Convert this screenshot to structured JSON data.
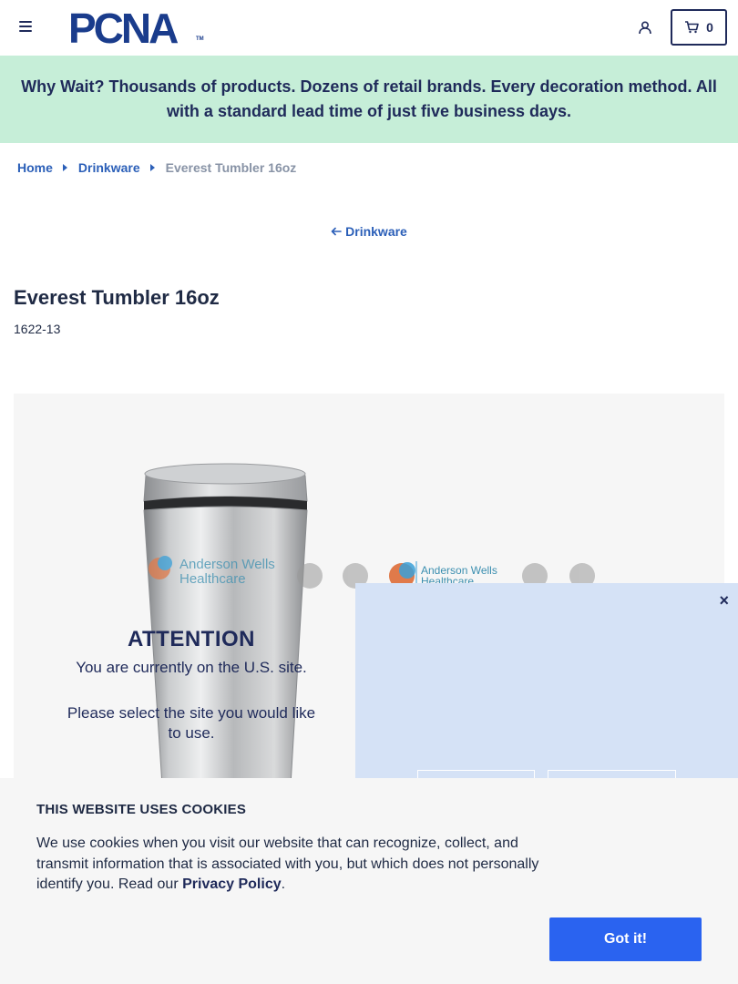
{
  "header": {
    "logo_text": "PCNA",
    "logo_tm": "TM",
    "cart_count": "0"
  },
  "banner": {
    "text": "Why Wait? Thousands of products. Dozens of retail brands. Every decoration method. All with a standard lead time of just five business days."
  },
  "breadcrumb": {
    "items": [
      "Home",
      "Drinkware"
    ],
    "current": "Everest Tumbler 16oz"
  },
  "back_link": {
    "label": "Drinkware"
  },
  "product": {
    "title": "Everest Tumbler 16oz",
    "sku": "1622-13",
    "imprint_text_line1": "Anderson Wells",
    "imprint_text_line2": "Healthcare"
  },
  "modal": {
    "title": "ATTENTION",
    "line1": "You are currently on the U.S. site.",
    "line2": "Please select the site you would like to use.",
    "close": "×"
  },
  "cookie": {
    "title": "THIS WEBSITE USES COOKIES",
    "body_prefix": "We use cookies when you visit our website that can recognize, collect, and transmit information that is associated with you, but which does not personally identify you. Read our ",
    "link_label": "Privacy Policy",
    "body_suffix": ".",
    "button_label": "Got it!"
  },
  "colors": {
    "navy": "#1f2a5a",
    "link_blue": "#2b5fb8",
    "banner_green": "#c6eed8",
    "modal_blue": "#d5e2f6",
    "button_blue": "#2a63f0"
  }
}
